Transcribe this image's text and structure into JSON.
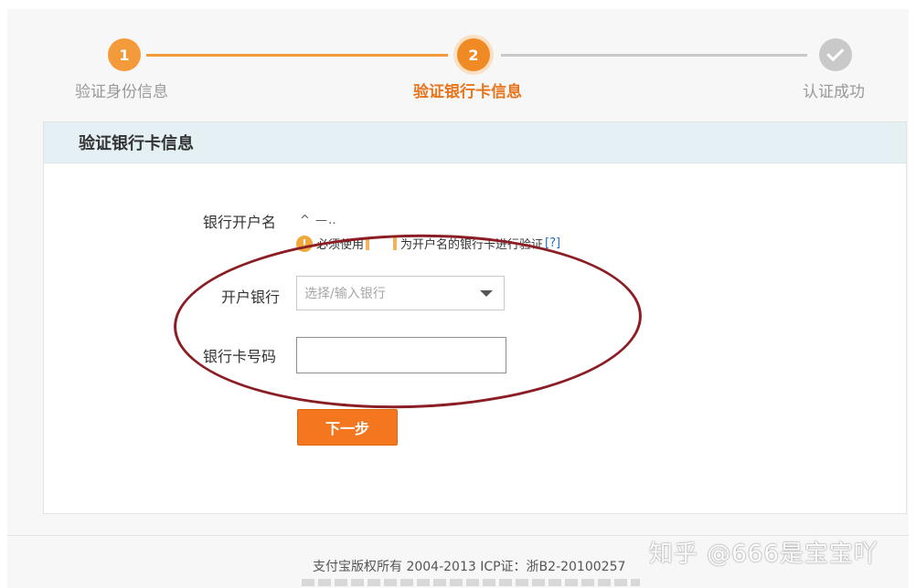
{
  "steps": [
    {
      "number": "1",
      "label": "验证身份信息"
    },
    {
      "number": "2",
      "label": "验证银行卡信息"
    },
    {
      "number": "",
      "label": "认证成功"
    }
  ],
  "panel": {
    "title": "验证银行卡信息"
  },
  "form": {
    "name_label": "银行开户名",
    "name_value": "^ —‥",
    "hint": {
      "icon_char": "!",
      "text_before": "必须使用",
      "text_after": "为开户名的银行卡进行验证",
      "link": "[?]"
    },
    "bank_label": "开户银行",
    "bank_placeholder": "选择/输入银行",
    "card_label": "银行卡号码",
    "card_value": "",
    "next_button": "下一步"
  },
  "footer": {
    "copyright": "支付宝版权所有 2004-2013 ICP证：浙B2-20100257"
  },
  "watermark": "知乎 @666是宝宝吖",
  "colors": {
    "accent": "#f4771f",
    "step_active": "#f08a24",
    "step_inactive": "#c9c9c9",
    "panel_header": "#e4f0f4",
    "annotation": "#8b1e24",
    "link": "#1d6fc4"
  }
}
